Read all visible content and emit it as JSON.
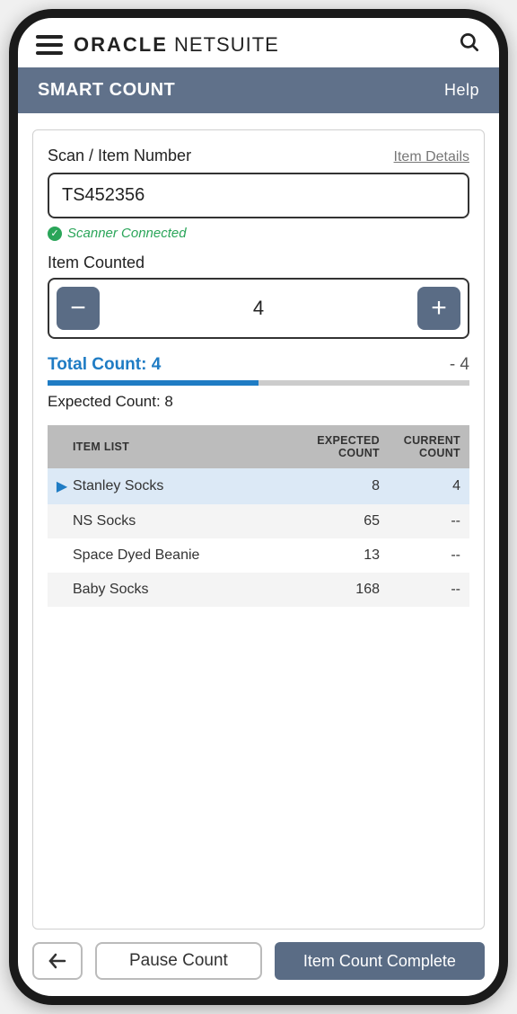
{
  "brand": {
    "prefix": "ORACLE",
    "suffix": "NETSUITE"
  },
  "titlebar": {
    "title": "SMART COUNT",
    "help": "Help"
  },
  "scan": {
    "label": "Scan / Item Number",
    "details_link": "Item Details",
    "value": "TS452356",
    "status_text": "Scanner Connected"
  },
  "counter": {
    "label": "Item Counted",
    "value": "4"
  },
  "totals": {
    "total_prefix": "Total Count: ",
    "total_value": "4",
    "diff": "- 4",
    "expected_label": "Expected Count: 8",
    "progress_pct": 50
  },
  "table": {
    "headers": {
      "item": "ITEM LIST",
      "expected": "EXPECTED COUNT",
      "current": "CURRENT COUNT"
    },
    "rows": [
      {
        "name": "Stanley Socks",
        "expected": "8",
        "current": "4",
        "active": true
      },
      {
        "name": "NS Socks",
        "expected": "65",
        "current": "--",
        "active": false
      },
      {
        "name": "Space Dyed Beanie",
        "expected": "13",
        "current": "--",
        "active": false
      },
      {
        "name": "Baby Socks",
        "expected": "168",
        "current": "--",
        "active": false
      }
    ]
  },
  "footer": {
    "pause": "Pause Count",
    "complete": "Item Count Complete"
  },
  "colors": {
    "accent": "#5a6c85",
    "link": "#1f7cc4",
    "success": "#2aa559"
  }
}
